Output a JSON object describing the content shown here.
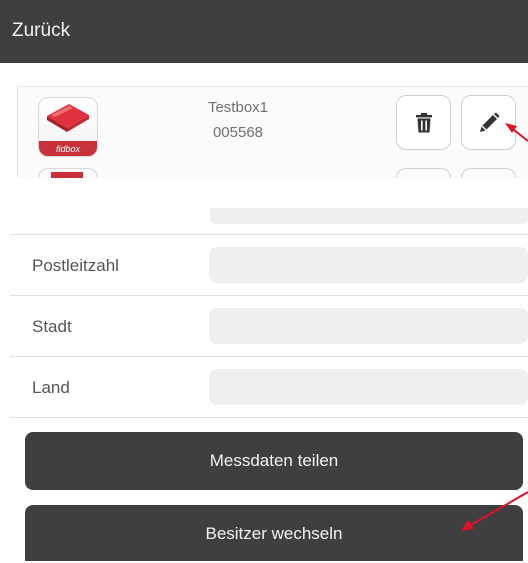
{
  "header": {
    "back_label": "Zurück"
  },
  "device": {
    "name": "Testbox1",
    "id": "005568",
    "app_icon_label": "fidbox",
    "delete_icon": "trash-icon",
    "edit_icon": "pencil-icon"
  },
  "form": {
    "fields": [
      {
        "label": "Postleitzahl",
        "value": ""
      },
      {
        "label": "Stadt",
        "value": ""
      },
      {
        "label": "Land",
        "value": ""
      }
    ]
  },
  "actions": {
    "share_label": "Messdaten teilen",
    "change_owner_label": "Besitzer wechseln"
  },
  "colors": {
    "header_bg": "#3f3f3f",
    "button_bg": "#3f3f3f",
    "annotation_arrow": "#e0102a",
    "brand_red": "#c9313a"
  }
}
